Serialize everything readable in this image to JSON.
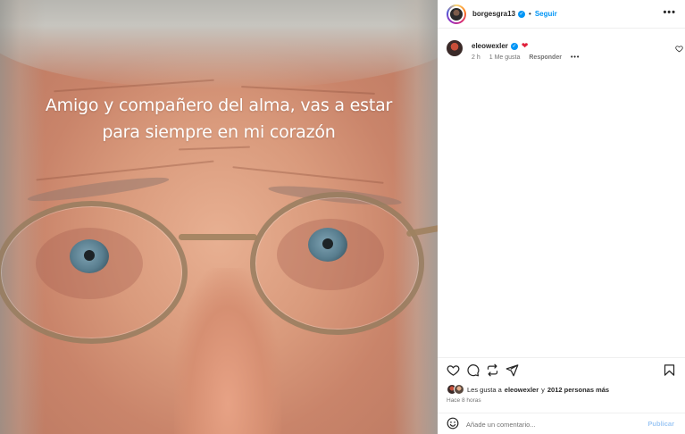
{
  "post": {
    "caption_line1": "Amigo y compañero del alma, vas a estar",
    "caption_line2": "para siempre en mi corazón"
  },
  "header": {
    "username": "borgesgra13",
    "separator": "•",
    "follow_label": "Seguir",
    "more_label": "•••"
  },
  "comment": {
    "username": "eleowexler",
    "text": "❤",
    "time": "2 h",
    "likes": "1 Me gusta",
    "reply_label": "Responder",
    "more_label": "•••"
  },
  "likes": {
    "prefix": "Les gusta a",
    "user": "eleowexler",
    "middle": "y",
    "count": "2012 personas más"
  },
  "timestamp": "Hace 8 horas",
  "add_comment": {
    "placeholder": "Añade un comentario...",
    "publish_label": "Publicar"
  },
  "icons": {
    "heart": "heart-icon",
    "comment": "comment-icon",
    "share": "share-icon",
    "repost": "repost-icon",
    "save": "bookmark-icon",
    "emoji": "emoji-icon",
    "verified": "verified-badge-icon"
  },
  "colors": {
    "accent": "#0095f6",
    "heart_red": "#e0203b",
    "muted": "#737373"
  }
}
